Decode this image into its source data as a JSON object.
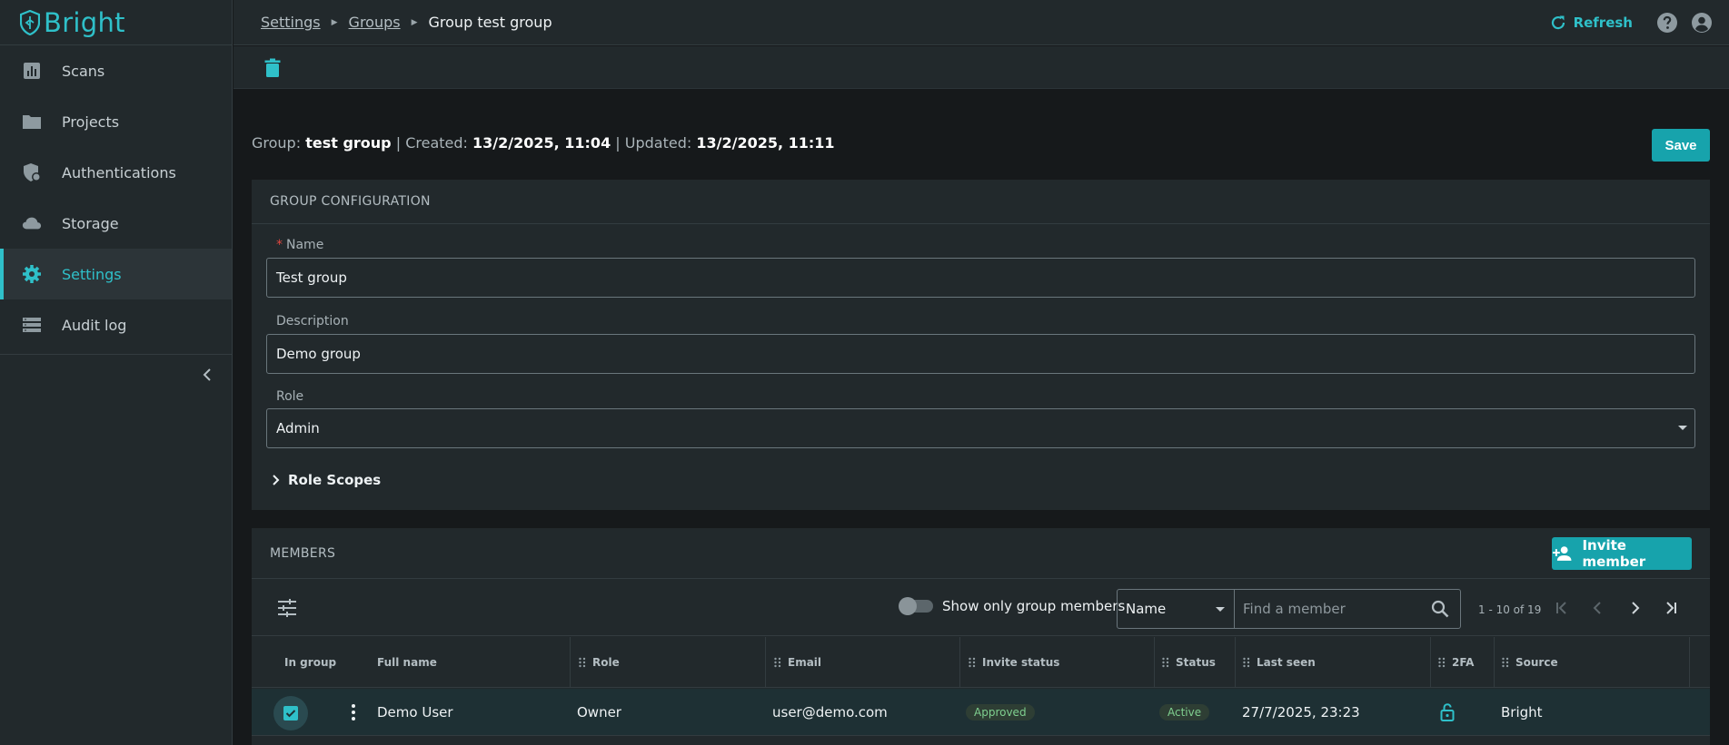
{
  "app": {
    "name": "Bright"
  },
  "sidebar": {
    "items": [
      {
        "label": "Scans",
        "icon": "chart-icon"
      },
      {
        "label": "Projects",
        "icon": "folder-icon"
      },
      {
        "label": "Authentications",
        "icon": "shield-lock-icon"
      },
      {
        "label": "Storage",
        "icon": "cloud-icon"
      },
      {
        "label": "Settings",
        "icon": "gear-icon",
        "active": true
      },
      {
        "label": "Audit log",
        "icon": "list-icon"
      }
    ]
  },
  "breadcrumb": {
    "items": [
      "Settings",
      "Groups"
    ],
    "current": "Group test group"
  },
  "topbar": {
    "refresh_label": "Refresh"
  },
  "info": {
    "group_label": "Group:",
    "group_name": "test group",
    "created_label": "| Created:",
    "created": "13/2/2025, 11:04",
    "updated_label": "| Updated:",
    "updated": "13/2/2025, 11:11"
  },
  "save_label": "Save",
  "config": {
    "title": "GROUP CONFIGURATION",
    "name_label": "Name",
    "name_value": "Test group",
    "description_label": "Description",
    "description_value": "Demo group",
    "role_label": "Role",
    "role_value": "Admin",
    "role_scopes_label": "Role Scopes"
  },
  "members": {
    "title": "MEMBERS",
    "invite_label": "Invite member",
    "toggle_label": "Show only group members",
    "filter_field": "Name",
    "search_placeholder": "Find a member",
    "range": "1 - 10 of 19",
    "columns": [
      "In group",
      "Full name",
      "Role",
      "Email",
      "Invite status",
      "Status",
      "Last seen",
      "2FA",
      "Source"
    ],
    "rows": [
      {
        "in_group": true,
        "full_name": "Demo User",
        "role": "Owner",
        "email": "user@demo.com",
        "invite_status": "Approved",
        "status": "Active",
        "last_seen": "27/7/2025, 23:23",
        "two_fa": "unlocked-icon",
        "source": "Bright"
      }
    ]
  },
  "colors": {
    "accent": "#2fc0c9",
    "button": "#17a3ac",
    "sidebar_bg": "#22292c",
    "page_bg": "#16191b"
  }
}
